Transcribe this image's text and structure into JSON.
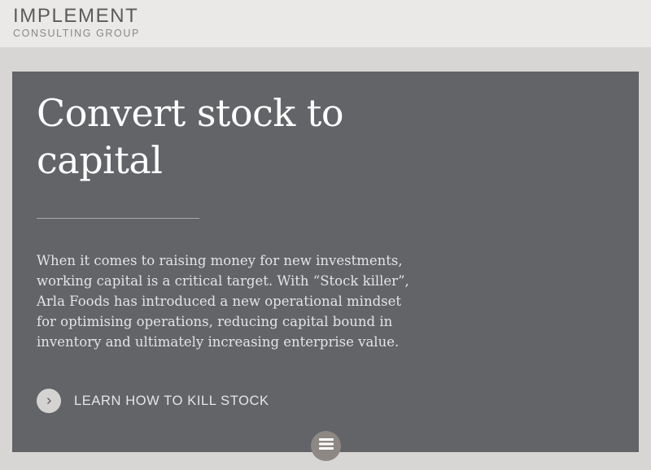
{
  "header": {
    "logo_main": "IMPLEMENT",
    "logo_sub": "CONSULTING GROUP"
  },
  "hero": {
    "title": "Convert stock to capital",
    "body": "When it comes to raising money for new investments, working capital is a critical target. With “Stock killer”, Arla Foods has introduced a new operational mindset for optimising operations, reducing capital bound in inventory and ultimately increasing enterprise value.",
    "cta_label": "LEARN HOW TO KILL STOCK",
    "cta_icon": "chevron-right-icon"
  },
  "menu": {
    "icon": "hamburger-menu-icon"
  },
  "colors": {
    "header_bg": "#ebe9e7",
    "page_bg": "#d8d6d4",
    "hero_bg": "#626468",
    "menu_button_bg": "#8d8883"
  }
}
